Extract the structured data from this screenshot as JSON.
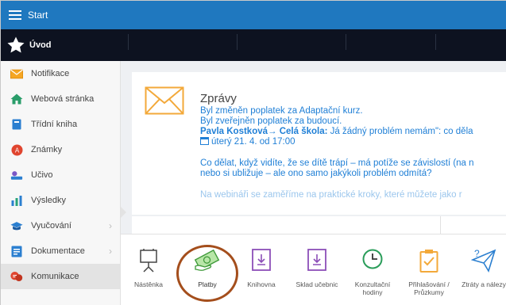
{
  "topbar": {
    "title": "Start"
  },
  "sidebar": {
    "header": "Úvod",
    "items": [
      {
        "label": "Notifikace",
        "icon": "envelope-icon"
      },
      {
        "label": "Webová stránka",
        "icon": "home-icon"
      },
      {
        "label": "Třídní kniha",
        "icon": "book-icon"
      },
      {
        "label": "Známky",
        "icon": "grades-icon"
      },
      {
        "label": "Učivo",
        "icon": "student-icon"
      },
      {
        "label": "Výsledky",
        "icon": "bar-chart-icon"
      },
      {
        "label": "Vyučování",
        "icon": "graduation-cap-icon"
      },
      {
        "label": "Dokumentace",
        "icon": "document-icon"
      },
      {
        "label": "Komunikace",
        "icon": "chat-icon"
      }
    ]
  },
  "messages": {
    "heading": "Zprávy",
    "line1": "Byl změněn poplatek za Adaptační kurz.",
    "line2": "Byl zveřejněn poplatek za budoucí.",
    "line3_author": "Pavla Kostková",
    "line3_arrow": "→",
    "line3_target": "Celá škola:",
    "line3_text": " Já žádný problém nemám\": co děla",
    "date": "úterý 21. 4. od 17:00",
    "line5": "Co dělat, když vidíte, že se dítě trápí – má potíže se závislostí (na n",
    "line6": "nebo si ubližuje – ale ono samo jakýkoli problém odmítá?",
    "line7": "Na webináři se zaměříme na praktické kroky, které můžete jako r"
  },
  "toolbar": {
    "items": [
      {
        "label": "Nástěnka",
        "icon": "noticeboard-icon"
      },
      {
        "label": "Platby",
        "icon": "payment-icon"
      },
      {
        "label": "Knihovna",
        "icon": "library-icon"
      },
      {
        "label": "Sklad učebnic",
        "icon": "textbook-store-icon"
      },
      {
        "label": "Konzultační hodiny",
        "icon": "clock-icon"
      },
      {
        "label": "Přihlašování / Průzkumy",
        "icon": "clipboard-icon"
      },
      {
        "label": "Ztráty a nálezy",
        "icon": "lost-found-icon"
      }
    ]
  },
  "colors": {
    "topbar": "#1f78bf",
    "navstrip": "#0d1220",
    "link": "#1f7fd6",
    "highlight": "#a44e1c",
    "icon_purple": "#8c4fb8",
    "icon_orange": "#f3a93a"
  }
}
